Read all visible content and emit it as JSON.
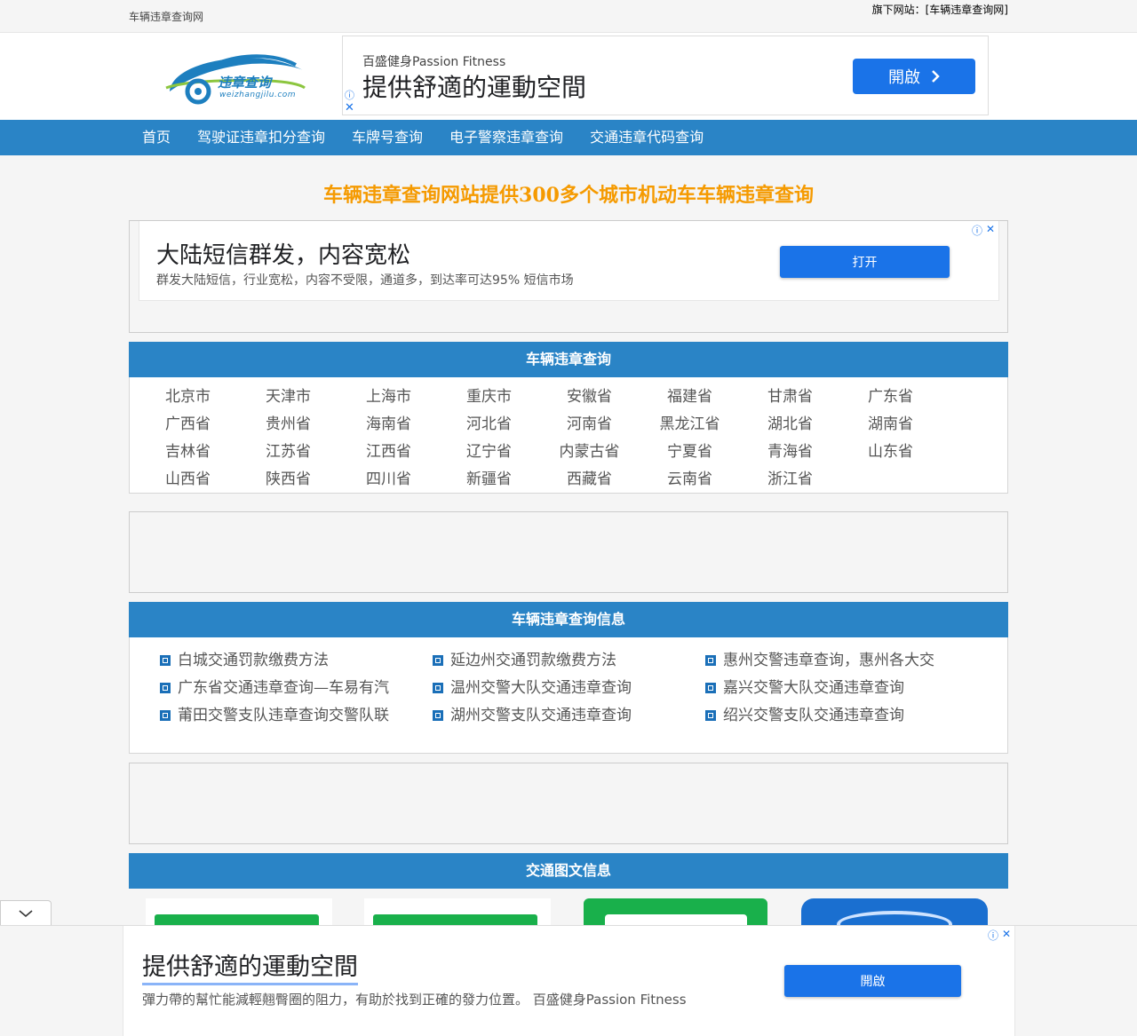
{
  "topbar": {
    "site_name": "车辆违章查询网",
    "sister_site": "旗下网站：[车辆违章查询网]"
  },
  "logo": {
    "text": "违章查询",
    "subtext": "weizhangjilu.com"
  },
  "ad_top": {
    "brand": "百盛健身Passion Fitness",
    "headline": "提供舒適的運動空間",
    "button": "開啟",
    "info_icon": "ⓘ",
    "close_icon": "✕"
  },
  "nav": {
    "items": [
      "首页",
      "驾驶证违章扣分查询",
      "车牌号查询",
      "电子警察违章查询",
      "交通违章代码查询"
    ]
  },
  "headline": "车辆违章查询网站提供300多个城市机动车车辆违章查询",
  "ad_middle": {
    "headline": "大陆短信群发，内容宽松",
    "description": "群发大陆短信，行业宽松，内容不受限，通道多，到达率可达95% 短信市场",
    "button": "打开",
    "info_icon": "ⓘ",
    "close_icon": "✕"
  },
  "cities_section": {
    "title": "车辆违章查询",
    "rows": [
      [
        "北京市",
        "天津市",
        "上海市",
        "重庆市",
        "安徽省",
        "福建省",
        "甘肃省",
        "广东省"
      ],
      [
        "广西省",
        "贵州省",
        "海南省",
        "河北省",
        "河南省",
        "黑龙江省",
        "湖北省",
        "湖南省"
      ],
      [
        "吉林省",
        "江苏省",
        "江西省",
        "辽宁省",
        "内蒙古省",
        "宁夏省",
        "青海省",
        "山东省"
      ],
      [
        "山西省",
        "陕西省",
        "四川省",
        "新疆省",
        "西藏省",
        "云南省",
        "浙江省"
      ]
    ]
  },
  "info_section": {
    "title": "车辆违章查询信息",
    "rows": [
      [
        "白城交通罚款缴费方法",
        "延边州交通罚款缴费方法",
        "惠州交警违章查询，惠州各大交"
      ],
      [
        "广东省交通违章查询—车易有汽",
        "温州交警大队交通违章查询",
        "嘉兴交警大队交通违章查询"
      ],
      [
        "莆田交警支队违章查询交警队联",
        "湖州交警支队交通违章查询",
        "绍兴交警支队交通违章查询"
      ]
    ]
  },
  "pics_section": {
    "title": "交通图文信息"
  },
  "collapse": {
    "icon": "⌄"
  },
  "ad_bottom": {
    "headline": "提供舒適的運動空間",
    "description": "彈力帶的幫忙能減輕翹臀圈的阻力，有助於找到正確的發力位置。 百盛健身Passion Fitness",
    "button": "開啟",
    "info_icon": "ⓘ",
    "close_icon": "✕"
  },
  "colors": {
    "nav_blue": "#2a84c6",
    "headline_orange": "#f59a00",
    "ad_button_blue": "#1a73e8"
  }
}
